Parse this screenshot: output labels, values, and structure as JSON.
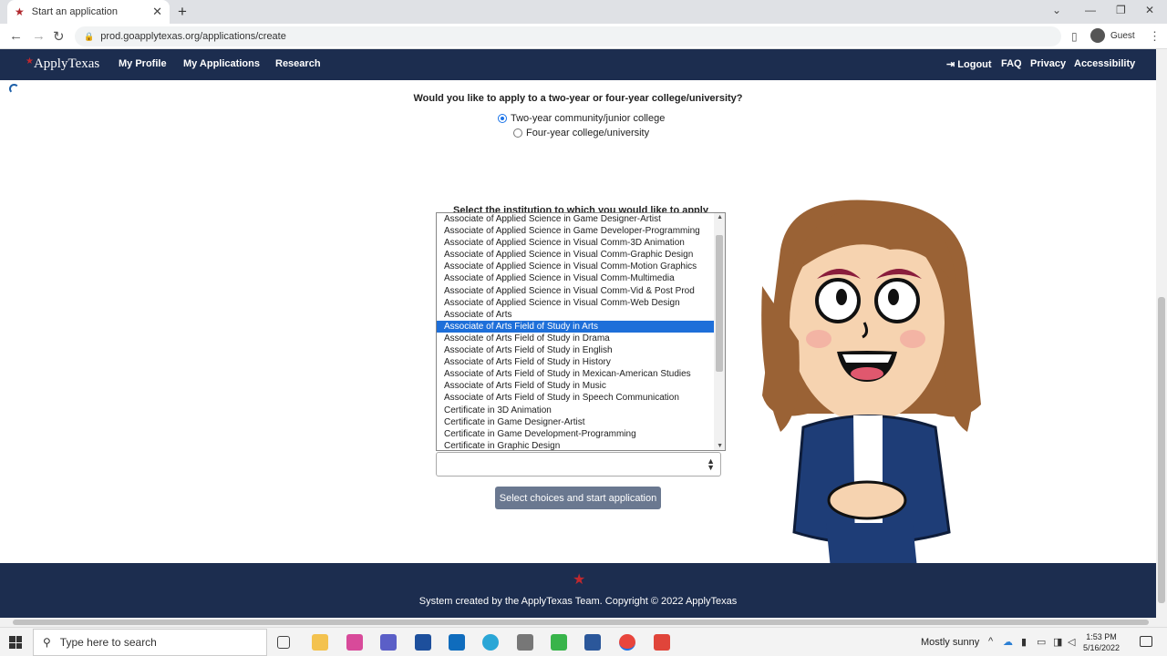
{
  "browser": {
    "tab_title": "Start an application",
    "url": "prod.goapplytexas.org/applications/create",
    "profile_label": "Guest"
  },
  "nav": {
    "logo": "ApplyTexas",
    "links": [
      "My Profile",
      "My Applications",
      "Research"
    ],
    "right_links": [
      "Logout",
      "FAQ",
      "Privacy",
      "Accessibility"
    ]
  },
  "form": {
    "question": "Would you like to apply to a two-year or four-year college/university?",
    "options": [
      {
        "label": "Two-year community/junior college",
        "selected": true
      },
      {
        "label": "Four-year college/university",
        "selected": false
      }
    ],
    "institution_label": "Select the institution to which you would like to apply",
    "dropdown_items": [
      "Associate of Applied Science in Game Designer-Artist",
      "Associate of Applied Science in Game Developer-Programming",
      "Associate of Applied Science in Visual Comm-3D Animation",
      "Associate of Applied Science in Visual Comm-Graphic Design",
      "Associate of Applied Science in Visual Comm-Motion Graphics",
      "Associate of Applied Science in Visual Comm-Multimedia",
      "Associate of Applied Science in Visual Comm-Vid & Post Prod",
      "Associate of Applied Science in Visual Comm-Web Design",
      "Associate of Arts",
      "Associate of Arts Field of Study in Arts",
      "Associate of Arts Field of Study in Drama",
      "Associate of Arts Field of Study in English",
      "Associate of Arts Field of Study in History",
      "Associate of Arts Field of Study in Mexican-American Studies",
      "Associate of Arts Field of Study in Music",
      "Associate of Arts Field of Study in Speech Communication",
      "Certificate in 3D Animation",
      "Certificate in Game Designer-Artist",
      "Certificate in Game Development-Programming",
      "Certificate in Graphic Design"
    ],
    "highlighted_index": 9,
    "start_button": "Select choices and start application"
  },
  "footer": {
    "text": "System created by the ApplyTexas Team. Copyright © 2022 ApplyTexas"
  },
  "taskbar": {
    "search_placeholder": "Type here to search",
    "weather": "Mostly sunny",
    "time": "1:53 PM",
    "date": "5/16/2022"
  },
  "colors": {
    "nav_bg": "#1c2d4f",
    "accent_red": "#c0282e",
    "highlight": "#1e6fd9",
    "button_bg": "#6a7890"
  }
}
